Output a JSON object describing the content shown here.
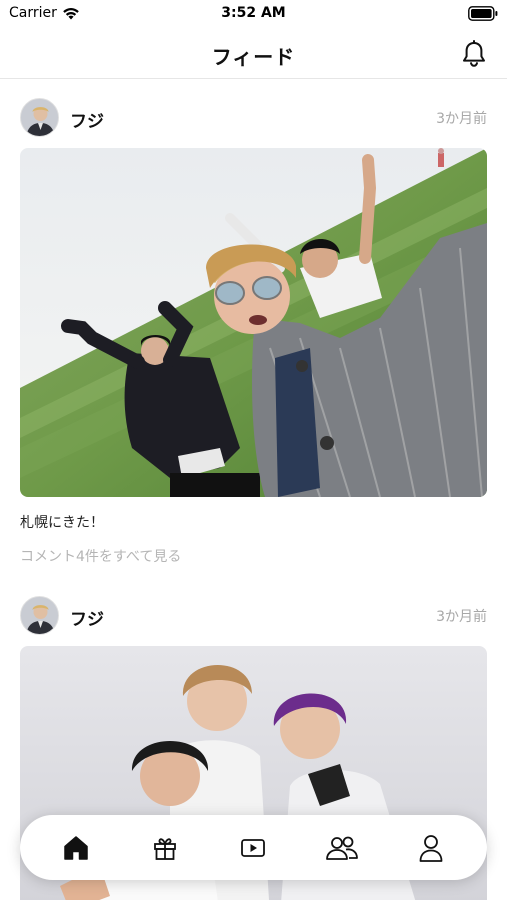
{
  "status_bar": {
    "carrier": "Carrier",
    "time": "3:52 AM",
    "wifi_icon": "wifi-icon",
    "battery_icon": "battery-full-icon"
  },
  "nav": {
    "title": "フィード",
    "notification_icon": "bell-icon"
  },
  "posts": [
    {
      "username": "フジ",
      "timestamp": "3か月前",
      "caption": "札幌にきた！",
      "comments_link": "コメント4件をすべて見る",
      "photo": "group-selfie-on-grassy-hill"
    },
    {
      "username": "フジ",
      "timestamp": "3か月前",
      "photo": "group-studio-portrait"
    }
  ],
  "tab_bar": {
    "tabs": [
      {
        "icon": "home-icon",
        "active": true
      },
      {
        "icon": "gift-icon",
        "active": false
      },
      {
        "icon": "video-play-icon",
        "active": false
      },
      {
        "icon": "friends-icon",
        "active": false
      },
      {
        "icon": "profile-icon",
        "active": false
      }
    ]
  },
  "colors": {
    "text_primary": "#111111",
    "text_muted": "#a8a8a8",
    "divider": "#e6e6e6",
    "background": "#ffffff"
  }
}
